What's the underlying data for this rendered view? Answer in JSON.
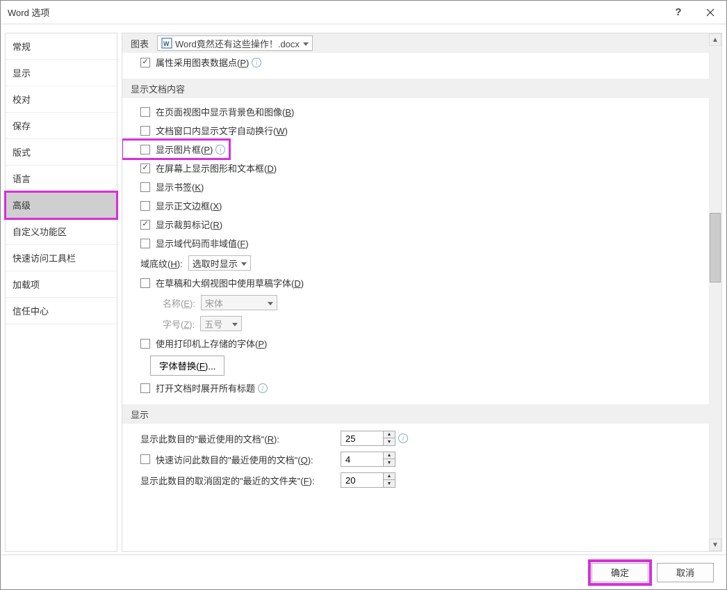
{
  "window": {
    "title": "Word 选项"
  },
  "sidebar": {
    "items": [
      {
        "label": "常规"
      },
      {
        "label": "显示"
      },
      {
        "label": "校对"
      },
      {
        "label": "保存"
      },
      {
        "label": "版式"
      },
      {
        "label": "语言"
      },
      {
        "label": "高级"
      },
      {
        "label": "自定义功能区"
      },
      {
        "label": "快速访问工具栏"
      },
      {
        "label": "加载项"
      },
      {
        "label": "信任中心"
      }
    ]
  },
  "chart_section": {
    "label": "图表",
    "doc_name": "Word竟然还有这些操作！.docx",
    "opt_chart_data": {
      "text": "属性采用图表数据点(",
      "key": "P",
      "suffix": ")"
    }
  },
  "doc_content_section": {
    "header": "显示文档内容",
    "opt_bg": {
      "text": "在页面视图中显示背景色和图像(",
      "key": "B",
      "suffix": ")"
    },
    "opt_wrap": {
      "text": "文档窗口内显示文字自动换行(",
      "key": "W",
      "suffix": ")"
    },
    "opt_picframe": {
      "text": "显示图片框(",
      "key": "P",
      "suffix": ")"
    },
    "opt_drawings": {
      "text": "在屏幕上显示图形和文本框(",
      "key": "D",
      "suffix": ")"
    },
    "opt_bookmarks": {
      "text": "显示书签(",
      "key": "K",
      "suffix": ")"
    },
    "opt_textbound": {
      "text": "显示正文边框(",
      "key": "X",
      "suffix": ")"
    },
    "opt_cropmarks": {
      "text": "显示裁剪标记(",
      "key": "R",
      "suffix": ")"
    },
    "opt_fieldcodes": {
      "text": "显示域代码而非域值(",
      "key": "F",
      "suffix": ")"
    },
    "field_shading": {
      "label_pre": "域底纹(",
      "key": "H",
      "label_suf": "):",
      "value": "选取时显示"
    },
    "opt_draftfont": {
      "text": "在草稿和大纲视图中使用草稿字体(",
      "key": "D",
      "suffix": ")"
    },
    "font_name": {
      "label_pre": "名称(",
      "key": "E",
      "label_suf": "):",
      "value": "宋体"
    },
    "font_size": {
      "label_pre": "字号(",
      "key": "Z",
      "label_suf": "):",
      "value": "五号"
    },
    "opt_printerfonts": {
      "text": "使用打印机上存储的字体(",
      "key": "P",
      "suffix": ")"
    },
    "btn_fontsubst": {
      "text": "字体替换(",
      "key": "F",
      "suffix": ")..."
    },
    "opt_expandall": {
      "text": "打开文档时展开所有标题"
    }
  },
  "display_section": {
    "header": "显示",
    "recent_docs": {
      "label_pre": "显示此数目的\"最近使用的文档\"(",
      "key": "R",
      "label_suf": "):",
      "value": "25"
    },
    "quick_access": {
      "label_pre": "快速访问此数目的\"最近使用的文档\"(",
      "key": "Q",
      "label_suf": "):",
      "value": "4"
    },
    "recent_folders": {
      "label_pre": "显示此数目的取消固定的\"最近的文件夹\"(",
      "key": "F",
      "label_suf": "):",
      "value": "20"
    }
  },
  "footer": {
    "ok": "确定",
    "cancel": "取消"
  }
}
